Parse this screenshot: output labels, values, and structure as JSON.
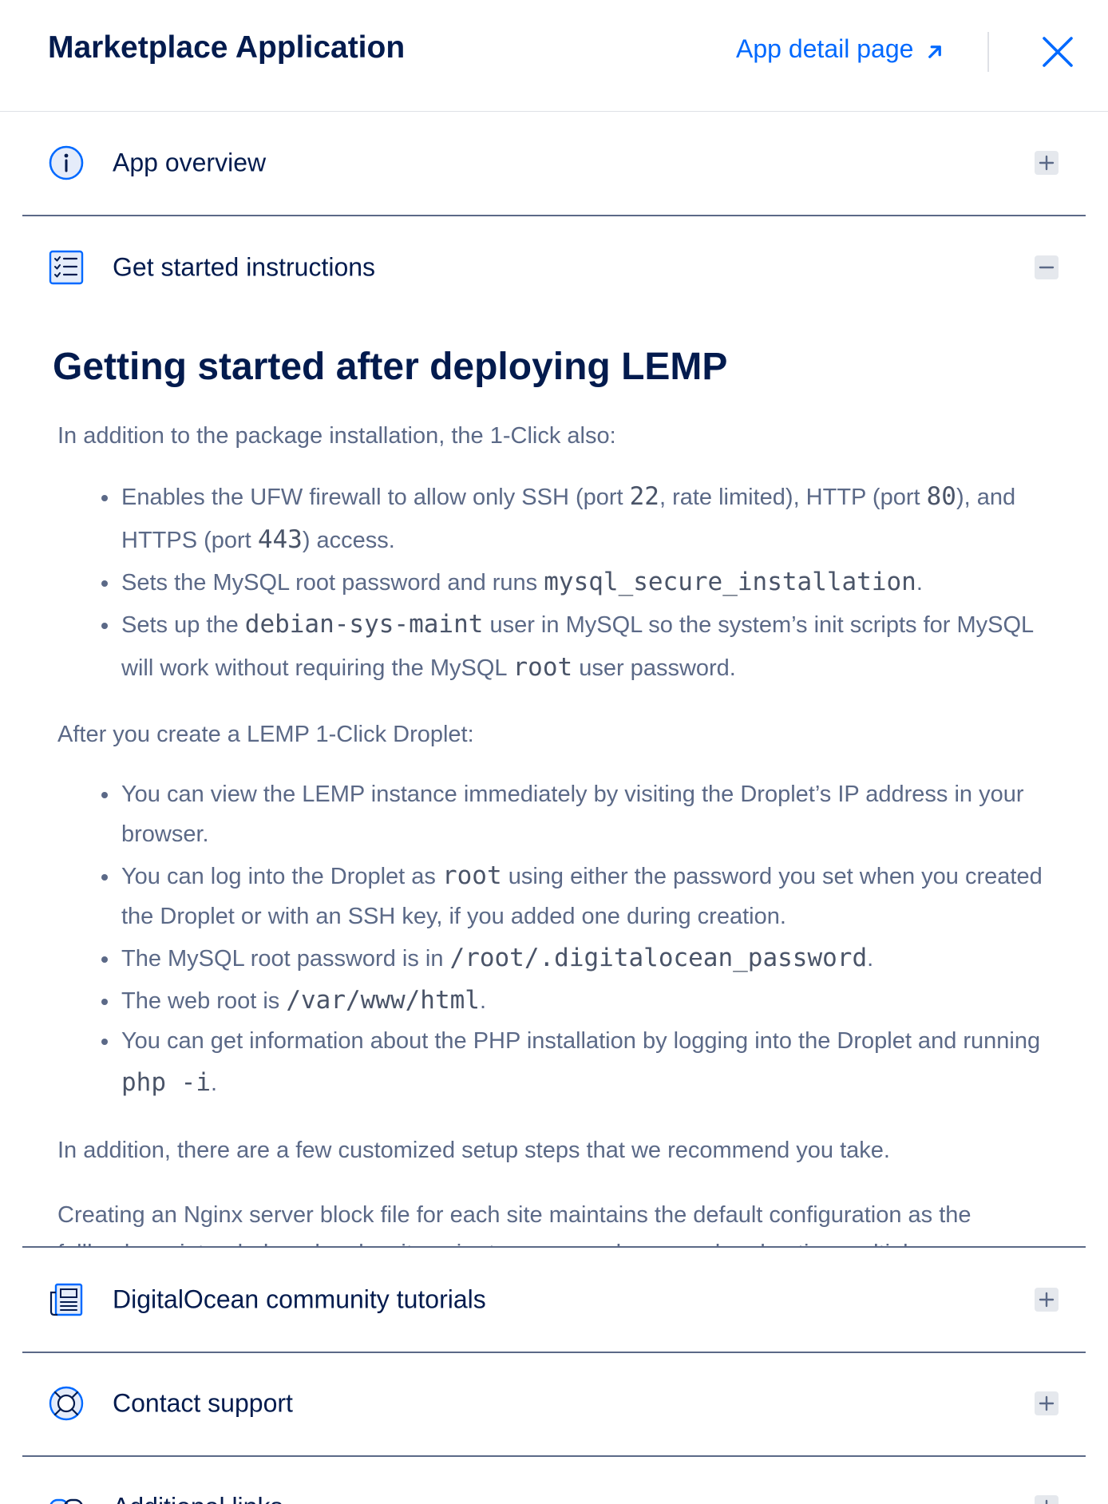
{
  "header": {
    "title": "Marketplace Application",
    "detail_link": "App detail page"
  },
  "accordion": {
    "overview": {
      "label": "App overview",
      "toggle": "+"
    },
    "instructions": {
      "label": "Get started instructions",
      "toggle": "−"
    },
    "tutorials": {
      "label": "DigitalOcean community tutorials",
      "toggle": "+"
    },
    "support": {
      "label": "Contact support",
      "toggle": "+"
    },
    "links": {
      "label": "Additional links",
      "toggle": "+"
    }
  },
  "instructions": {
    "heading": "Getting started after deploying LEMP",
    "intro": "In addition to the package installation, the 1-Click also:",
    "list1": {
      "item1": {
        "t1": "Enables the UFW firewall to allow only SSH (port ",
        "c1": "22",
        "t2": ", rate limited), HTTP (port ",
        "c2": "80",
        "t3": "), and HTTPS (port ",
        "c3": "443",
        "t4": ") access."
      },
      "item2": {
        "t1": "Sets the MySQL root password and runs ",
        "c1": "mysql_secure_installation",
        "t2": "."
      },
      "item3": {
        "t1": "Sets up the ",
        "c1": "debian-sys-maint",
        "t2": " user in MySQL so the system’s init scripts for MySQL will work without requiring the MySQL ",
        "c2": "root",
        "t3": " user password."
      }
    },
    "after": "After you create a LEMP 1-Click Droplet:",
    "list2": {
      "item1": {
        "t1": "You can view the LEMP instance immediately by visiting the Droplet’s IP address in your browser."
      },
      "item2": {
        "t1": "You can log into the Droplet as ",
        "c1": "root",
        "t2": " using either the password you set when you created the Droplet or with an SSH key, if you added one during creation."
      },
      "item3": {
        "t1": "The MySQL root password is in ",
        "c1": "/root/.digitalocean_password",
        "t2": "."
      },
      "item4": {
        "t1": "The web root is ",
        "c1": "/var/www/html",
        "t2": "."
      },
      "item5": {
        "t1": "You can get information about the PHP installation by logging into the Droplet and running ",
        "c1": "php -i",
        "t2": "."
      }
    },
    "custom": "In addition, there are a few customized setup steps that we recommend you take.",
    "nginx": "Creating an Nginx server block file for each site maintains the default configuration as the fallback, as intended, and makes it easier to manage changes when hosting multiple"
  },
  "colors": {
    "text_dark": "#031b4e",
    "text_body": "#5b6987",
    "link": "#0069ff",
    "divider": "#5b6987"
  }
}
